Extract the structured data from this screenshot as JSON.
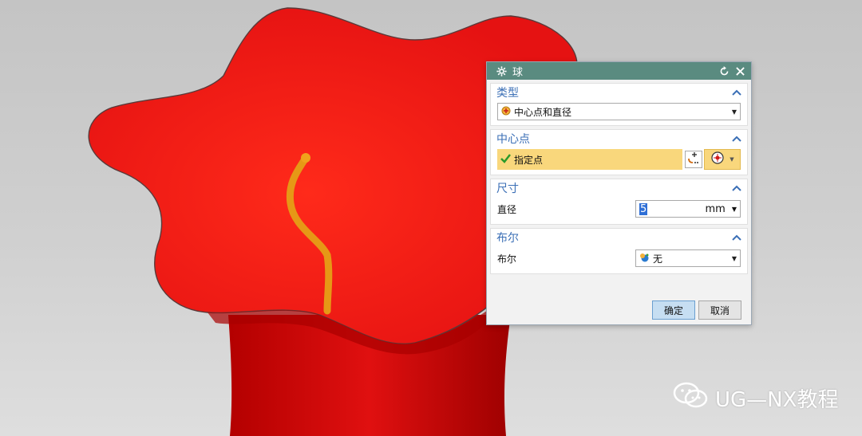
{
  "dialog": {
    "title": "球",
    "sections": {
      "type": {
        "header": "类型",
        "selected": "中心点和直径"
      },
      "center": {
        "header": "中心点",
        "specify_label": "指定点"
      },
      "size": {
        "header": "尺寸",
        "field_label": "直径",
        "value": "5",
        "unit": "mm"
      },
      "boolean": {
        "header": "布尔",
        "field_label": "布尔",
        "selected": "无"
      }
    },
    "buttons": {
      "ok": "确定",
      "cancel": "取消"
    }
  },
  "watermark": {
    "text": "UG—NX教程"
  },
  "colors": {
    "titlebar": "#5a8b80",
    "section_header": "#3b6fb6",
    "highlight": "#f9d77c",
    "flower": "#e31414",
    "stem": "#f0a21c"
  }
}
